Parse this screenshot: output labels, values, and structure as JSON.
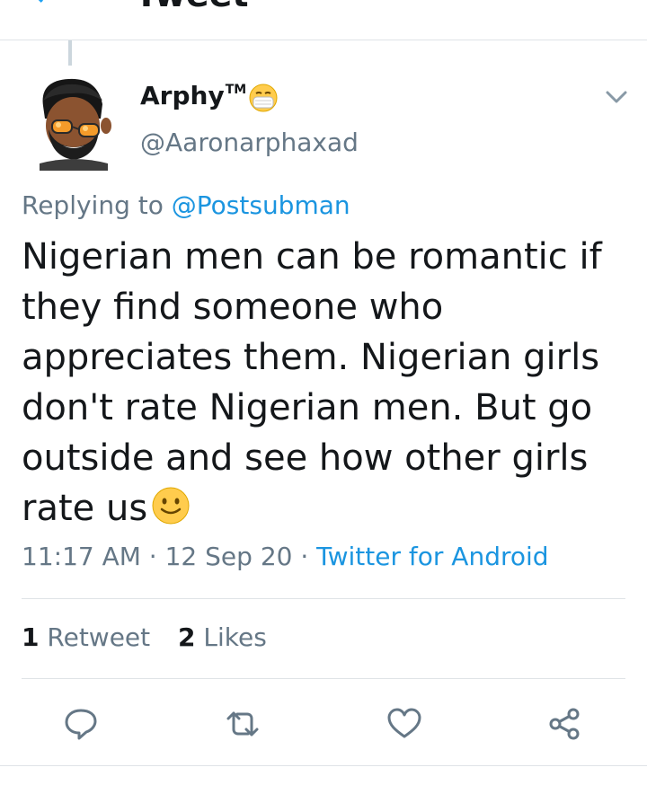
{
  "header": {
    "title": "Tweet",
    "back_icon": "back-arrow-icon"
  },
  "tweet": {
    "author": {
      "display_name": "Arphy",
      "tm": "TM",
      "handle": "@Aaronarphaxad",
      "badge_icon": "face-with-mask-emoji"
    },
    "replying_prefix": "Replying to",
    "replying_to": "@Postsubman",
    "text": "Nigerian men can be romantic if they find someone who appreciates them. Nigerian girls don't rate Nigerian men. But go outside and see how other girls rate us",
    "text_emoji": "slightly-smiling-face-emoji",
    "time": "11:17 AM",
    "date": "12 Sep 20",
    "source": "Twitter for Android",
    "retweets": {
      "count": "1",
      "label": "Retweet"
    },
    "likes": {
      "count": "2",
      "label": "Likes"
    }
  },
  "actions": [
    "reply-icon",
    "retweet-icon",
    "like-icon",
    "share-icon"
  ],
  "colors": {
    "accent": "#1b95e0",
    "secondary_text": "#657786",
    "primary_text": "#14171a",
    "divider": "#dfe3e7"
  }
}
